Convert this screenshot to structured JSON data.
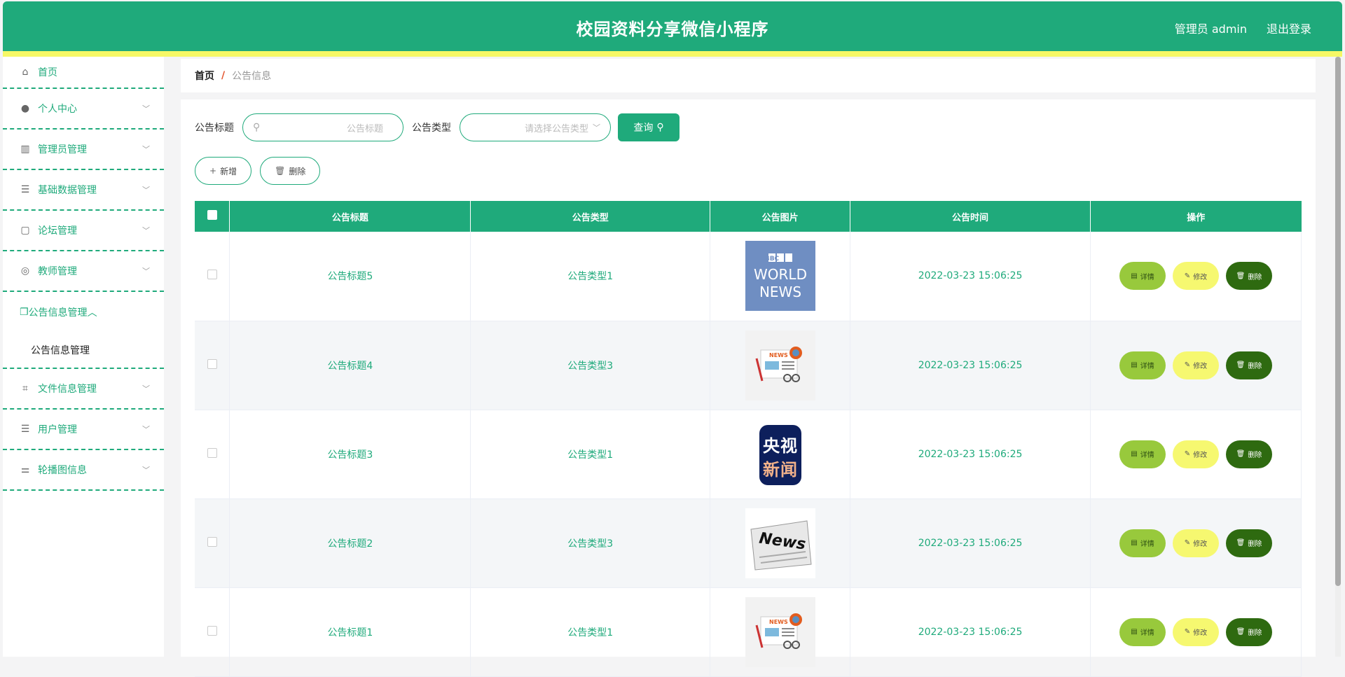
{
  "header": {
    "title": "校园资料分享微信小程序",
    "user": "管理员 admin",
    "logout": "退出登录"
  },
  "sidebar": {
    "items": [
      {
        "label": "首页",
        "icon": "home-icon"
      },
      {
        "label": "个人中心",
        "icon": "user-icon"
      },
      {
        "label": "管理员管理",
        "icon": "books-icon"
      },
      {
        "label": "基础数据管理",
        "icon": "list-icon"
      },
      {
        "label": "论坛管理",
        "icon": "chat-icon"
      },
      {
        "label": "教师管理",
        "icon": "ring-icon"
      },
      {
        "label": "公告信息管理",
        "icon": "copy-icon",
        "sub": "公告信息管理"
      },
      {
        "label": "文件信息管理",
        "icon": "crop-icon"
      },
      {
        "label": "用户管理",
        "icon": "list-icon"
      },
      {
        "label": "轮播图信息",
        "icon": "sliders-icon"
      }
    ]
  },
  "breadcrumb": {
    "home": "首页",
    "sep": "/",
    "current": "公告信息"
  },
  "search": {
    "title_label": "公告标题",
    "title_placeholder": "公告标题",
    "type_label": "公告类型",
    "type_placeholder": "请选择公告类型",
    "query": "查询"
  },
  "actions": {
    "add": "新增",
    "delete": "删除"
  },
  "table": {
    "headers": [
      "公告标题",
      "公告类型",
      "公告图片",
      "公告时间",
      "操作"
    ],
    "rows": [
      {
        "title": "公告标题5",
        "type": "公告类型1",
        "image": "bbc",
        "time": "2022-03-23 15:06:25"
      },
      {
        "title": "公告标题4",
        "type": "公告类型3",
        "image": "paper",
        "time": "2022-03-23 15:06:25"
      },
      {
        "title": "公告标题3",
        "type": "公告类型1",
        "image": "cctv",
        "time": "2022-03-23 15:06:25"
      },
      {
        "title": "公告标题2",
        "type": "公告类型3",
        "image": "news",
        "time": "2022-03-23 15:06:25"
      },
      {
        "title": "公告标题1",
        "type": "公告类型1",
        "image": "paper",
        "time": "2022-03-23 15:06:25"
      }
    ],
    "ops": {
      "detail": "详情",
      "edit": "修改",
      "delete": "删除"
    }
  },
  "images": {
    "bbc": {
      "line1": "BBC",
      "line2": "WORLD",
      "line3": "NEWS"
    },
    "paper": {
      "label": "NEWS"
    },
    "cctv": {
      "text": "央视新闻"
    },
    "news": {
      "label": "News"
    }
  },
  "colors": {
    "primary": "#1faa7b",
    "accent": "#f6f866",
    "detail": "#98c93c",
    "edit": "#f6f870",
    "delete": "#2e6a10"
  }
}
